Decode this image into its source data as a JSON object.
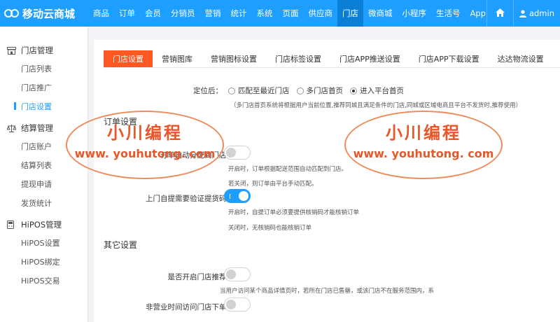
{
  "app": {
    "title": "移动云商城"
  },
  "topnav": {
    "items": [
      "商品",
      "订单",
      "会员",
      "分销员",
      "营销",
      "统计",
      "系统",
      "页面",
      "供应商",
      "门店",
      "微商城",
      "小程序",
      "生活号",
      "App"
    ],
    "active_index": 9,
    "user": "admin"
  },
  "sidebar": {
    "groups": [
      {
        "title": "门店管理",
        "icon": "store-icon",
        "items": [
          "门店列表",
          "门店推广",
          "门店设置"
        ]
      },
      {
        "title": "结算管理",
        "icon": "balance-scale-icon",
        "items": [
          "门店账户",
          "结算列表",
          "提现申请",
          "发货统计"
        ]
      },
      {
        "title": "HiPOS管理",
        "icon": "pos-device-icon",
        "items": [
          "HiPOS设置",
          "HiPOS绑定",
          "HiPOS交易"
        ]
      }
    ],
    "active_item": "门店设置"
  },
  "tabs": {
    "items": [
      "门店设置",
      "营销图库",
      "营销图标设置",
      "门店标签设置",
      "门店APP推送设置",
      "门店APP下载设置",
      "达达物流设置"
    ],
    "active_index": 0
  },
  "location": {
    "label": "定位后：",
    "options": [
      "匹配至最近门店",
      "多门店首页",
      "进入平台首页"
    ],
    "selected_index": 2,
    "note": "（多门店首页系统将根据用户当前位置,推荐同城且满足条件的门店,同城或区域电商且平台不发货时,推荐使用）"
  },
  "order_settings": {
    "title": "订单设置",
    "auto_match": {
      "label": "订单自动分配到门店：",
      "enabled": false,
      "hint_on": "开启时，订单根据配送范围自动匹配到门店。",
      "hint_off": "若关闭，则订单由平台手动匹配。"
    },
    "verify_code": {
      "label": "上门自提需要验证提货码：",
      "enabled": true,
      "hint_on": "开启时，自提订单必须要提供核销码才能核销订单",
      "hint_off": "关闭时，无核销码也能核销订单"
    }
  },
  "other_settings": {
    "title": "其它设置",
    "recommend": {
      "label": "是否开启门店推荐：",
      "enabled": false,
      "hint": "当用户访问某个商品详情页时，若所在门店已售罄，或该门店不在服务范围内，系"
    },
    "off_hours": {
      "label": "非营业时间访问门店下单：",
      "enabled": false
    }
  },
  "watermark": {
    "title": "小川编程",
    "url": "www. youhutong. com"
  },
  "colors": {
    "topbar": "#1e9fff",
    "active_nav": "#0b7fd6",
    "active_tab": "#ff5722",
    "watermark": "#e8572a"
  }
}
